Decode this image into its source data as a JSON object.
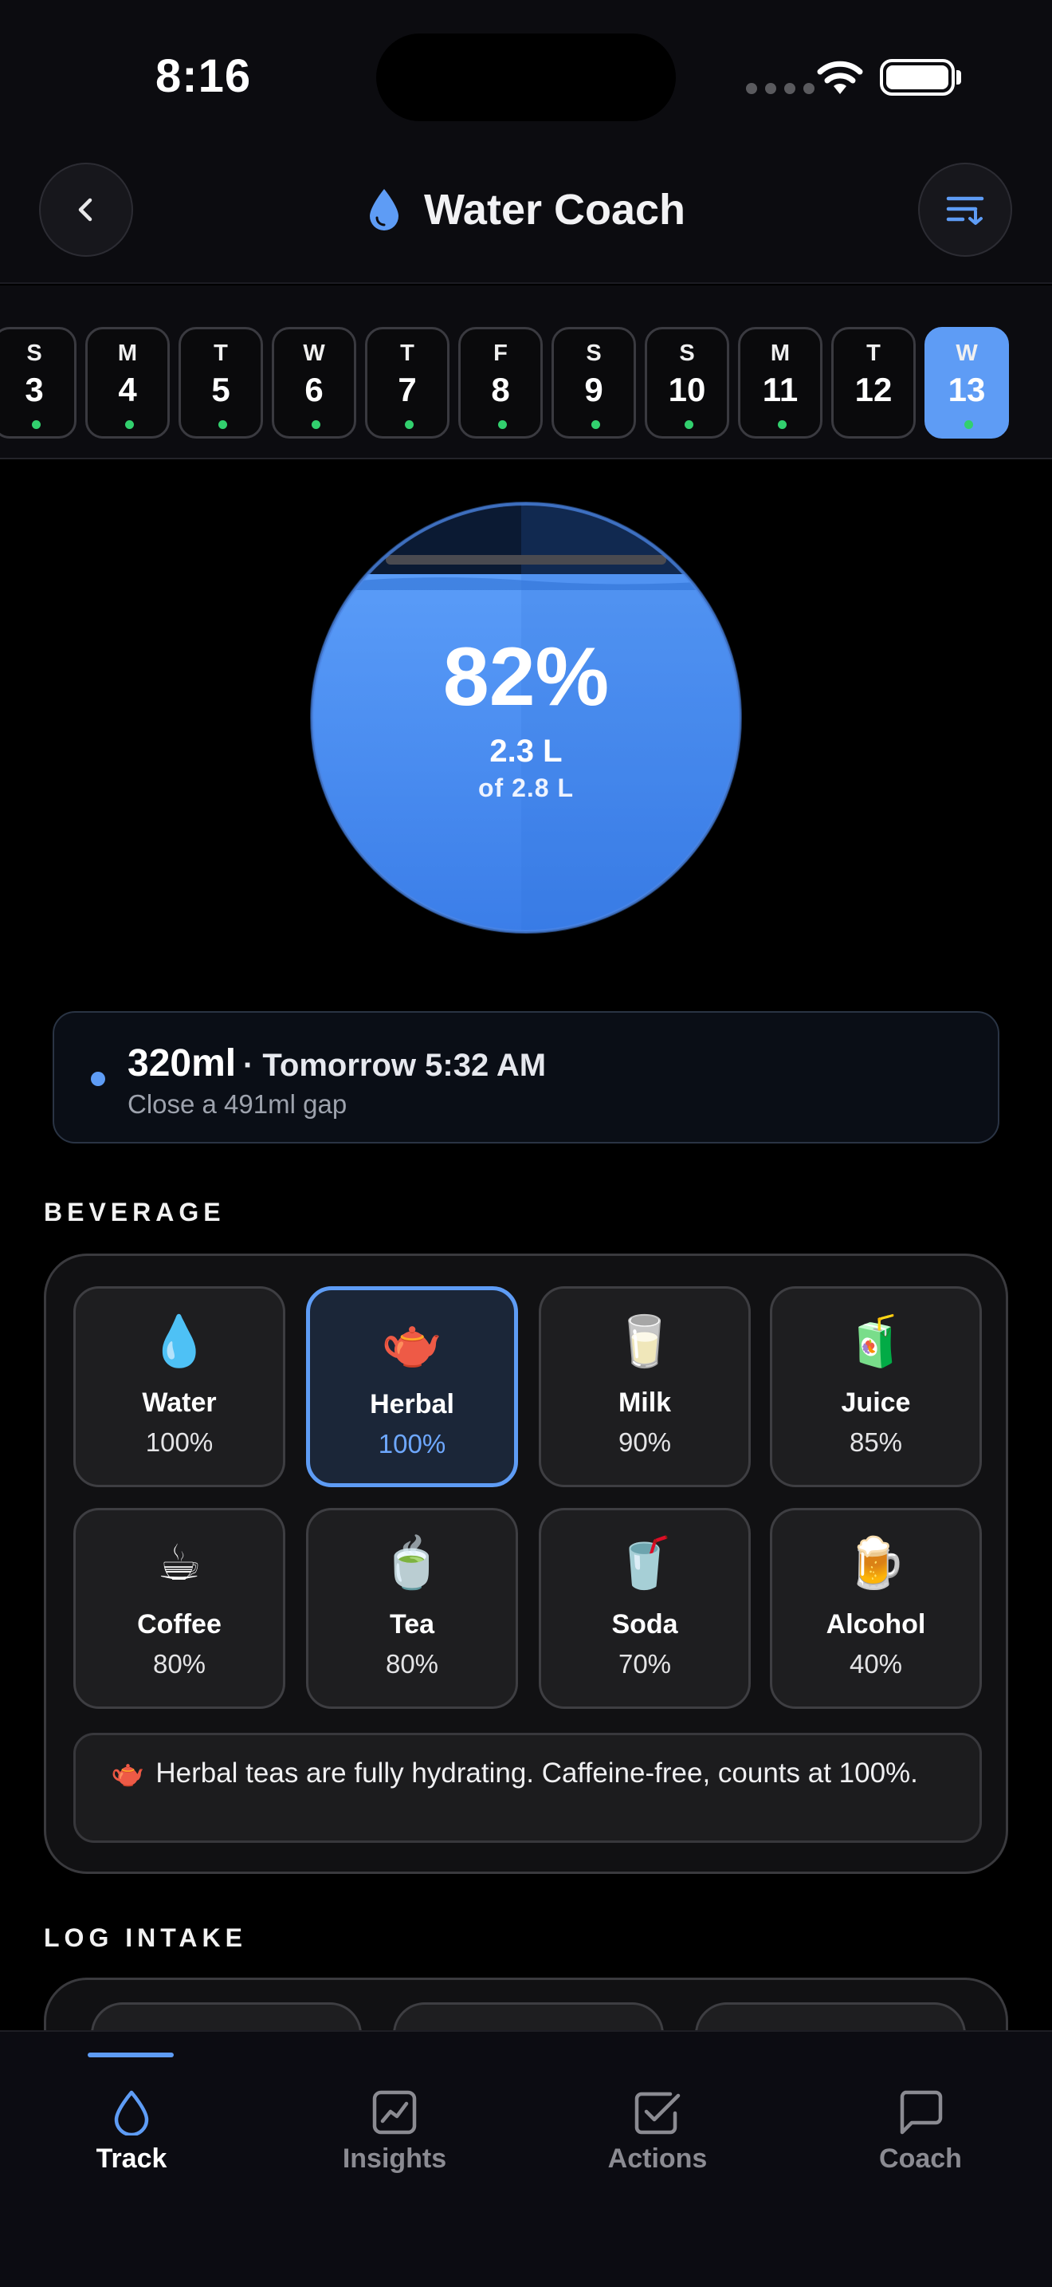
{
  "status_bar": {
    "time": "8:16"
  },
  "header": {
    "title": "Water Coach"
  },
  "date_strip": [
    {
      "dow": "S",
      "day": "3",
      "dot": true,
      "selected": false
    },
    {
      "dow": "M",
      "day": "4",
      "dot": true,
      "selected": false
    },
    {
      "dow": "T",
      "day": "5",
      "dot": true,
      "selected": false
    },
    {
      "dow": "W",
      "day": "6",
      "dot": true,
      "selected": false
    },
    {
      "dow": "T",
      "day": "7",
      "dot": true,
      "selected": false
    },
    {
      "dow": "F",
      "day": "8",
      "dot": true,
      "selected": false
    },
    {
      "dow": "S",
      "day": "9",
      "dot": true,
      "selected": false
    },
    {
      "dow": "S",
      "day": "10",
      "dot": true,
      "selected": false
    },
    {
      "dow": "M",
      "day": "11",
      "dot": true,
      "selected": false
    },
    {
      "dow": "T",
      "day": "12",
      "dot": false,
      "selected": false
    },
    {
      "dow": "W",
      "day": "13",
      "dot": true,
      "selected": true
    }
  ],
  "progress": {
    "percent_label": "82%",
    "percent": 82,
    "intake_label": "2.3 L",
    "goal_label": "of 2.8 L"
  },
  "reminder": {
    "amount": "320ml",
    "when": "· Tomorrow 5:32 AM",
    "detail": "Close a 491ml gap"
  },
  "beverage": {
    "section_label": "BEVERAGE",
    "items": [
      {
        "emoji": "💧",
        "name": "Water",
        "pct": "100%",
        "selected": false
      },
      {
        "emoji": "🫖",
        "name": "Herbal",
        "pct": "100%",
        "selected": true
      },
      {
        "emoji": "🥛",
        "name": "Milk",
        "pct": "90%",
        "selected": false
      },
      {
        "emoji": "🧃",
        "name": "Juice",
        "pct": "85%",
        "selected": false
      },
      {
        "emoji": "☕",
        "name": "Coffee",
        "pct": "80%",
        "selected": false
      },
      {
        "emoji": "🍵",
        "name": "Tea",
        "pct": "80%",
        "selected": false
      },
      {
        "emoji": "🥤",
        "name": "Soda",
        "pct": "70%",
        "selected": false
      },
      {
        "emoji": "🍺",
        "name": "Alcohol",
        "pct": "40%",
        "selected": false
      }
    ],
    "tip_emoji": "🫖",
    "tip_text": "Herbal teas are fully hydrating. Caffeine-free, counts at 100%."
  },
  "log_intake": {
    "section_label": "LOG INTAKE"
  },
  "tabs": [
    {
      "label": "Track",
      "icon": "drop-icon",
      "active": true
    },
    {
      "label": "Insights",
      "icon": "chart-icon",
      "active": false
    },
    {
      "label": "Actions",
      "icon": "checkbox-icon",
      "active": false
    },
    {
      "label": "Coach",
      "icon": "chat-icon",
      "active": false
    }
  ],
  "colors": {
    "accent": "#5e9cf5",
    "dot_green": "#32d06e",
    "background": "#000000"
  }
}
